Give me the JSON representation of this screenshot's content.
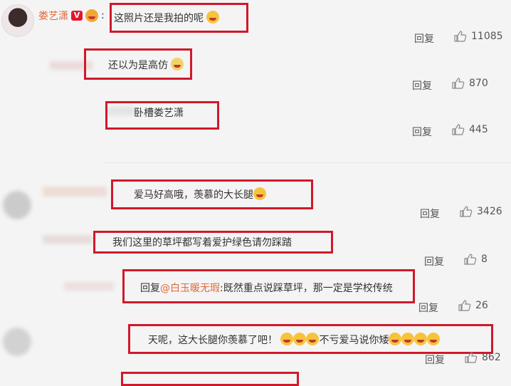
{
  "header_user": {
    "name": "娄艺潇",
    "badge": "V"
  },
  "comments": [
    {
      "text": "这照片还是我拍的呢",
      "reply": "回复",
      "likes": "11085"
    },
    {
      "text": "还以为是高仿",
      "reply": "回复",
      "likes": "870"
    },
    {
      "text": "卧槽娄艺潇",
      "reply": "回复",
      "likes": "445"
    },
    {
      "text": "爱马好高哦，羡慕的大长腿",
      "reply": "回复",
      "likes": "3426"
    },
    {
      "text": "我们这里的草坪都写着爱护绿色请勿踩踏",
      "reply": "回复",
      "likes": "8"
    },
    {
      "text_prefix": "回复",
      "mention": "@白玉暖无瑕",
      "text": ":既然重点说踩草坪，那一定是学校传统",
      "reply": "回复",
      "likes": "26"
    },
    {
      "text": "天呢，这大长腿你羡慕了吧！",
      "text2": "不亏爱马说你矮",
      "reply": "回复",
      "likes": "862"
    }
  ]
}
